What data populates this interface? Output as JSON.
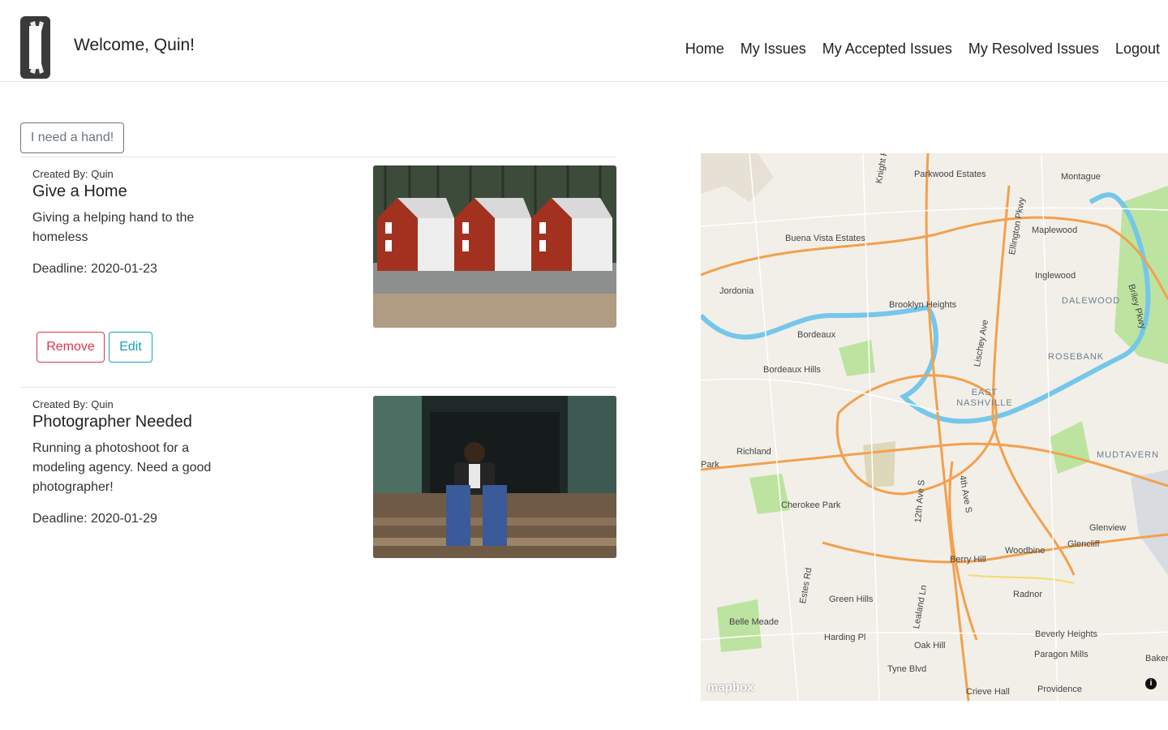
{
  "header": {
    "welcome": "Welcome, Quin!",
    "nav": [
      "Home",
      "My Issues",
      "My Accepted Issues",
      "My Resolved Issues",
      "Logout"
    ]
  },
  "actions": {
    "need_hand": "I need a hand!"
  },
  "issues": [
    {
      "created_by": "Created By: Quin",
      "title": "Give a Home",
      "description": "Giving a helping hand to the homeless",
      "deadline": "Deadline: 2020-01-23",
      "remove_label": "Remove",
      "edit_label": "Edit"
    },
    {
      "created_by": "Created By: Quin",
      "title": "Photographer Needed",
      "description": "Running a photoshoot for a modeling agency. Need a good photographer!",
      "deadline": "Deadline: 2020-01-29"
    }
  ],
  "map": {
    "attribution": "mapbox",
    "places": [
      "Parkwood Estates",
      "Montague",
      "Maplewood",
      "Buena Vista Estates",
      "Inglewood",
      "Jordonia",
      "DALEWOOD",
      "Brooklyn Heights",
      "Bordeaux",
      "ROSEBANK",
      "Bordeaux Hills",
      "EAST NASHVILLE",
      "Richland",
      "MUDTAVERN",
      "Park",
      "Cherokee Park",
      "Glenview",
      "Glencliff",
      "Woodbine",
      "Berry Hill",
      "Radnor",
      "Green Hills",
      "Belle Meade",
      "Harding Pl",
      "Beverly Heights",
      "Oak Hill",
      "Paragon Mills",
      "Bakertow",
      "Tyne Blvd",
      "Crieve Hall",
      "Providence",
      "Knight Rd",
      "Ellington Pkwy",
      "Briley Pkwy",
      "Lischey Ave",
      "12th Ave S",
      "4th Ave S",
      "Estes Rd",
      "Lealand Ln"
    ]
  }
}
